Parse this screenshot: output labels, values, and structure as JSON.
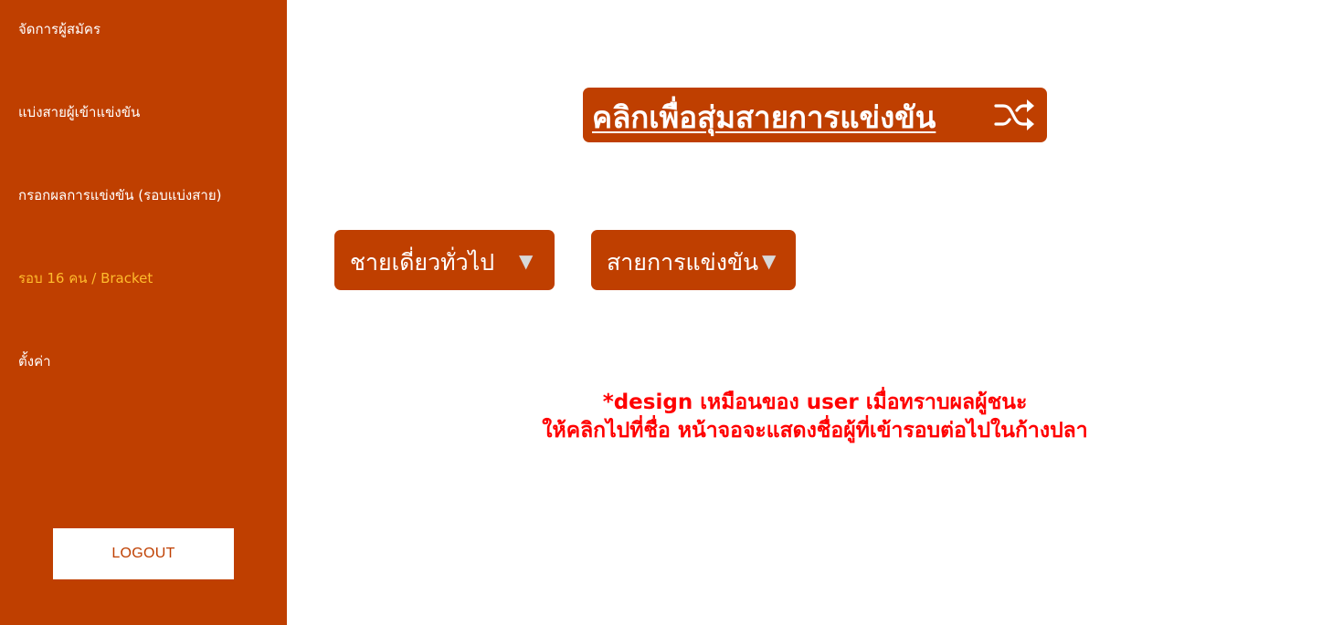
{
  "sidebar": {
    "items": [
      {
        "label": "จัดการผู้สมัคร"
      },
      {
        "label": "แบ่งสายผู้เข้าแข่งขัน"
      },
      {
        "label": "กรอกผลการแข่งขัน (รอบแบ่งสาย)"
      },
      {
        "label": "รอบ 16 คน / Bracket"
      },
      {
        "label": "ตั้งค่า"
      }
    ],
    "logout_label": "LOGOUT"
  },
  "main": {
    "random_button_label": "คลิกเพื่อสุ่มสายการแข่งขัน",
    "random_button_icon": "shuffle-icon",
    "category_select": {
      "selected": "ชายเดี่ยวทั่วไป",
      "arrow": "▼"
    },
    "bracket_select": {
      "selected": "สายการแข่งขัน",
      "arrow": "▼"
    },
    "note": [
      "*design เหมือนของ user เมื่อทราบผลผู้ชนะ",
      "ให้คลิกไปที่ชื่อ หน้าจอจะแสดงชื่อผู้ที่เข้ารอบต่อไปในก้างปลา"
    ]
  },
  "colors": {
    "brand": "#bf3f00",
    "active_nav": "#ffbc2c",
    "note_text": "#ff0000"
  }
}
